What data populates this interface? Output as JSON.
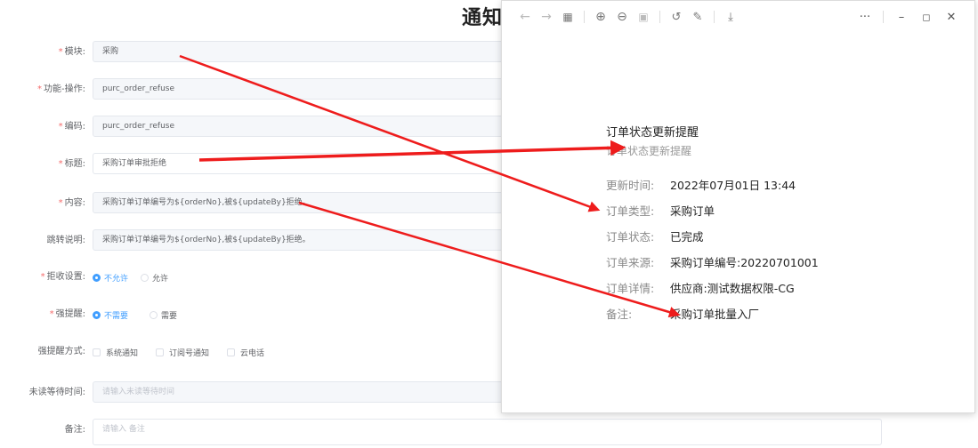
{
  "page": {
    "title": "通知"
  },
  "form": {
    "module": {
      "label": "模块:",
      "value": "采购",
      "required": "*"
    },
    "function_op": {
      "label": "功能-操作:",
      "value": "purc_order_refuse",
      "required": "*"
    },
    "code": {
      "label": "编码:",
      "value": "purc_order_refuse",
      "required": "*"
    },
    "title": {
      "label": "标题:",
      "value": "采购订单审批拒绝",
      "required": "*"
    },
    "content": {
      "label": "内容:",
      "value": "采购订单订单编号为${orderNo},被${updateBy}拒绝。",
      "required": "*"
    },
    "jump_desc": {
      "label": "跳转说明:",
      "value": "采购订单订单编号为${orderNo},被${updateBy}拒绝。"
    },
    "refuse_setting": {
      "label": "拒收设置:",
      "required": "*",
      "options": [
        "不允许",
        "允许"
      ],
      "selected": 0
    },
    "strong_remind": {
      "label": "强提醒:",
      "required": "*",
      "options": [
        "不需要",
        "需要"
      ],
      "selected": 0
    },
    "remind_method": {
      "label": "强提醒方式:",
      "options": [
        "系统通知",
        "订阅号通知",
        "云电话"
      ]
    },
    "unread_wait": {
      "label": "未读等待时间:",
      "placeholder": "请输入未读等待时间"
    },
    "remark": {
      "label": "备注:",
      "placeholder": "请输入 备注"
    }
  },
  "popup": {
    "notice_title": "订单状态更新提醒",
    "notice_subtitle": "订单状态更新提醒",
    "rows": [
      {
        "key": "更新时间:",
        "value": "2022年07月01日 13:44"
      },
      {
        "key": "订单类型:",
        "value": "采购订单"
      },
      {
        "key": "订单状态:",
        "value": "已完成"
      },
      {
        "key": "订单来源:",
        "value": "采购订单编号:20220701001"
      },
      {
        "key": "订单详情:",
        "value": "供应商:测试数据权限-CG"
      },
      {
        "key": "备注:",
        "value": "采购订单批量入厂"
      }
    ],
    "toolbar_icons": [
      "back-arrow-icon",
      "forward-arrow-icon",
      "grid-icon",
      "zoom-in-icon",
      "zoom-out-icon",
      "fit-page-icon",
      "rotate-icon",
      "edit-icon",
      "download-icon",
      "more-icon",
      "minimize-icon",
      "maximize-icon",
      "close-icon"
    ]
  },
  "colors": {
    "accent": "#409eff",
    "required": "#f56c6c",
    "arrow": "#ee1c1c"
  }
}
